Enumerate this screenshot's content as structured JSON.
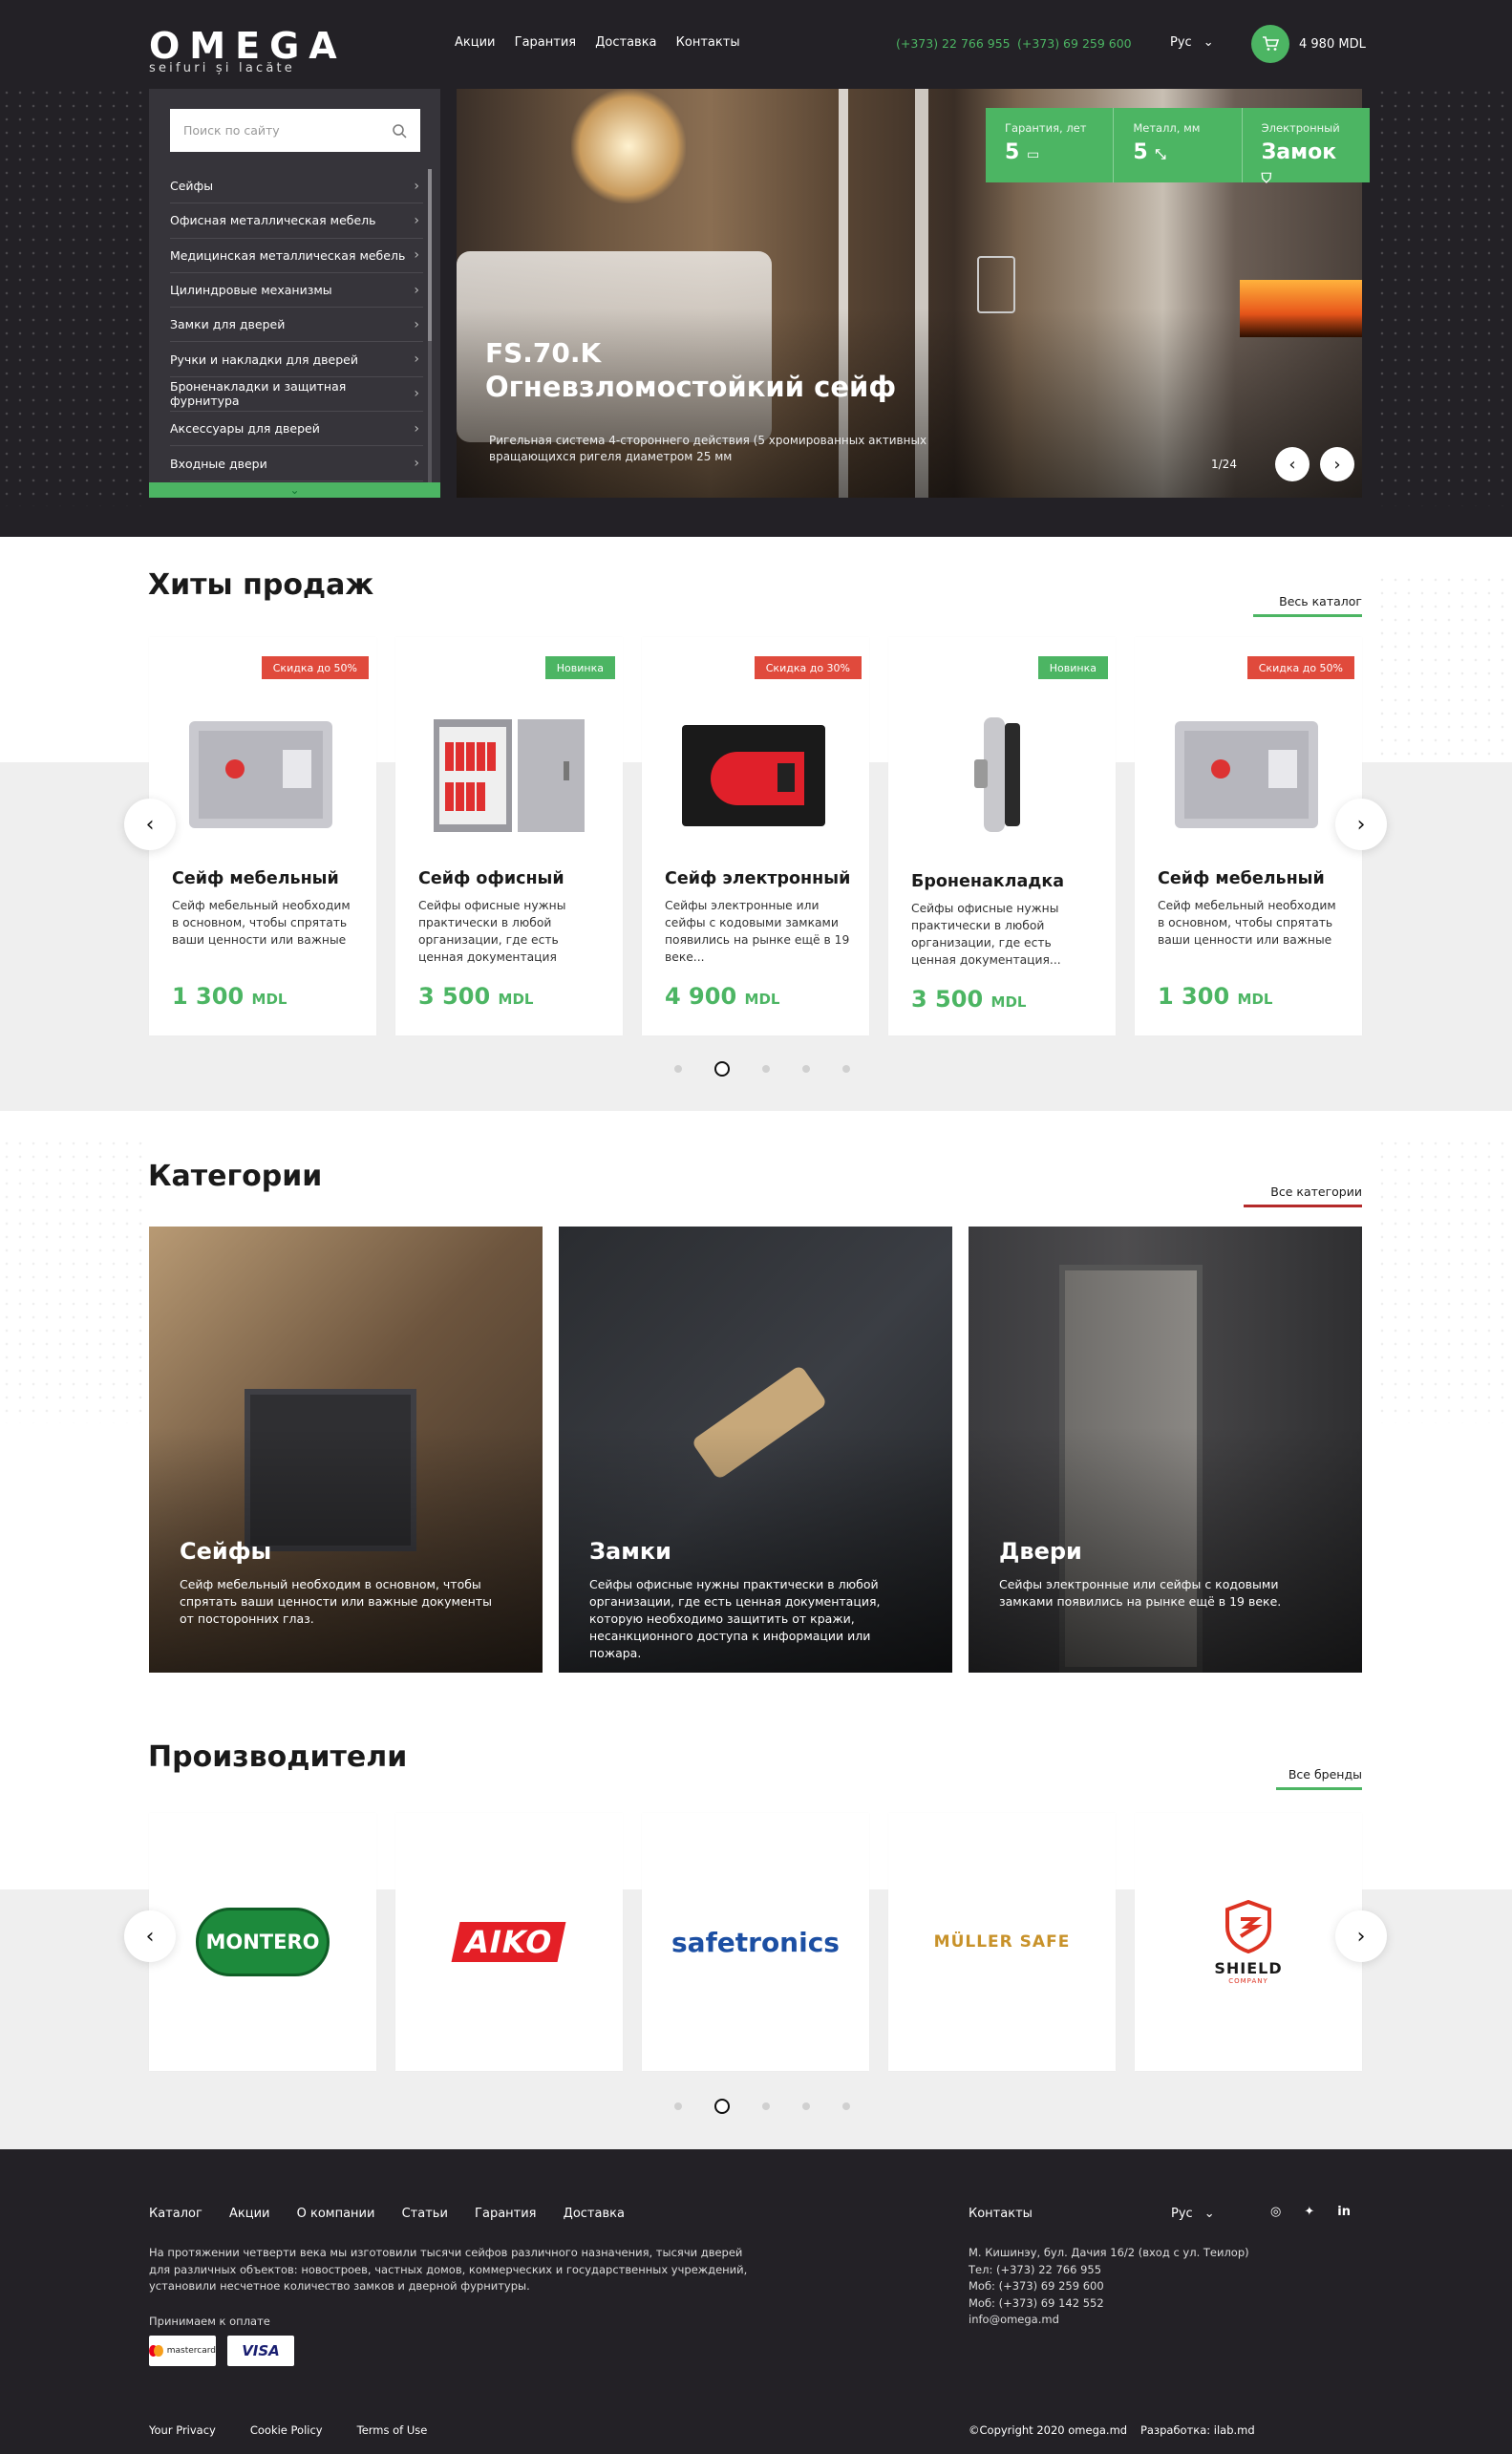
{
  "brand": {
    "name": "OMEGA",
    "tagline": "seifuri și lacăte"
  },
  "header": {
    "nav": [
      "Акции",
      "Гарантия",
      "Доставка",
      "Контакты"
    ],
    "phones": [
      "(+373) 22 766 955",
      "(+373) 69 259 600"
    ],
    "language": "Рус",
    "cart_total": "4 980  MDL"
  },
  "sidebar": {
    "search_placeholder": "Поиск по сайту",
    "items": [
      {
        "label": "Сейфы"
      },
      {
        "label": "Офисная металлическая мебель"
      },
      {
        "label": "Медицинская металлическая мебель"
      },
      {
        "label": "Цилиндровые механизмы"
      },
      {
        "label": "Замки для дверей"
      },
      {
        "label": "Ручки и накладки для дверей"
      },
      {
        "label": "Броненакладки и защитная фурнитура"
      },
      {
        "label": "Аксессуары для дверей"
      },
      {
        "label": "Входные двери"
      }
    ]
  },
  "hero": {
    "model": "FS.70.K",
    "title": "Огневзломостойкий сейф",
    "description": "Ригельная система 4-стороннего действия (5 хромированных активных вращающихся ригеля диаметром  25 мм",
    "counter": "1/24",
    "specs": [
      {
        "label": "Гарантия, лет",
        "value": "5",
        "icon": "document-icon"
      },
      {
        "label": "Металл, мм",
        "value": "5",
        "icon": "compress-icon"
      },
      {
        "label": "Электронный",
        "value": "Замок",
        "icon": "shield-icon"
      }
    ]
  },
  "bestsellers": {
    "title": "Хиты продаж",
    "see_all": "Весь каталог",
    "accent": "#4cb563",
    "products": [
      {
        "badge": "Скидка до 50%",
        "badge_color": "#e04a3c",
        "name": "Сейф мебельный",
        "description": "Сейф мебельный необходим в основном, чтобы спрятать ваши ценности или важные",
        "price": "1 300",
        "currency": "MDL"
      },
      {
        "badge": "Новинка",
        "badge_color": "#4cb563",
        "name": "Сейф офисный",
        "description": "Сейфы офисные нужны практически в любой организации, где есть ценная документация",
        "price": "3 500",
        "currency": "MDL"
      },
      {
        "badge": "Скидка до 30%",
        "badge_color": "#e04a3c",
        "name": "Сейф электронный",
        "description": "Сейфы электронные или сейфы с кодовыми замками появились на рынке ещё в 19 веке...",
        "price": "4 900",
        "currency": "MDL"
      },
      {
        "badge": "Новинка",
        "badge_color": "#4cb563",
        "name": "Броненакладка",
        "description": "Сейфы офисные нужны практически в любой организации, где есть ценная документация...",
        "price": "3 500",
        "currency": "MDL"
      },
      {
        "badge": "Скидка до 50%",
        "badge_color": "#e04a3c",
        "name": "Сейф мебельный",
        "description": "Сейф мебельный необходим в основном, чтобы спрятать ваши ценности или важные",
        "price": "1 300",
        "currency": "MDL"
      }
    ]
  },
  "categories": {
    "title": "Категории",
    "see_all": "Все категории",
    "accent": "#b42a2a",
    "items": [
      {
        "name": "Сейфы",
        "description": "Сейф мебельный необходим в основном, чтобы спрятать ваши ценности или важные документы от посторонних глаз."
      },
      {
        "name": "Замки",
        "description": "Сейфы офисные нужны практически в любой организации, где есть ценная документация, которую необходимо защитить от кражи, несанкционного доступа к информации или пожара."
      },
      {
        "name": "Двери",
        "description": "Сейфы электронные или сейфы с кодовыми замками появились на рынке ещё в 19 веке."
      }
    ]
  },
  "brands": {
    "title": "Производители",
    "see_all": "Все бренды",
    "items": [
      "MONTERO",
      "AIKO",
      "safetronics",
      "MÜLLER SAFE",
      "SHIELD"
    ],
    "shield_sub": "COMPANY"
  },
  "footer": {
    "nav": [
      "Каталог",
      "Акции",
      "О компании",
      "Статьи",
      "Гарантия",
      "Доставка"
    ],
    "about": "На протяжении четверти века мы изготовили тысячи сейфов различного назначения, тысячи дверей для различных объектов: новостроев, частных домов, коммерческих и государственных учреждений, установили несчетное количество замков и дверной фурнитуры.",
    "payment_label": "Принимаем к оплате",
    "payments": [
      "mastercard",
      "VISA"
    ],
    "contacts_title": "Контакты",
    "language": "Рус",
    "contacts": [
      "М. Кишинэу, бул. Дачия 16/2 (вход с ул. Теилор)",
      "Тел: (+373) 22 766 955",
      "Моб: (+373) 69 259 600",
      "Моб: (+373) 69 142 552",
      "info@omega.md"
    ],
    "legal": [
      "Your Privacy",
      "Cookie Policy",
      "Terms of Use"
    ],
    "copyright": "©Copyright 2020 omega.md",
    "developer": "Разработка: ilab.md"
  }
}
